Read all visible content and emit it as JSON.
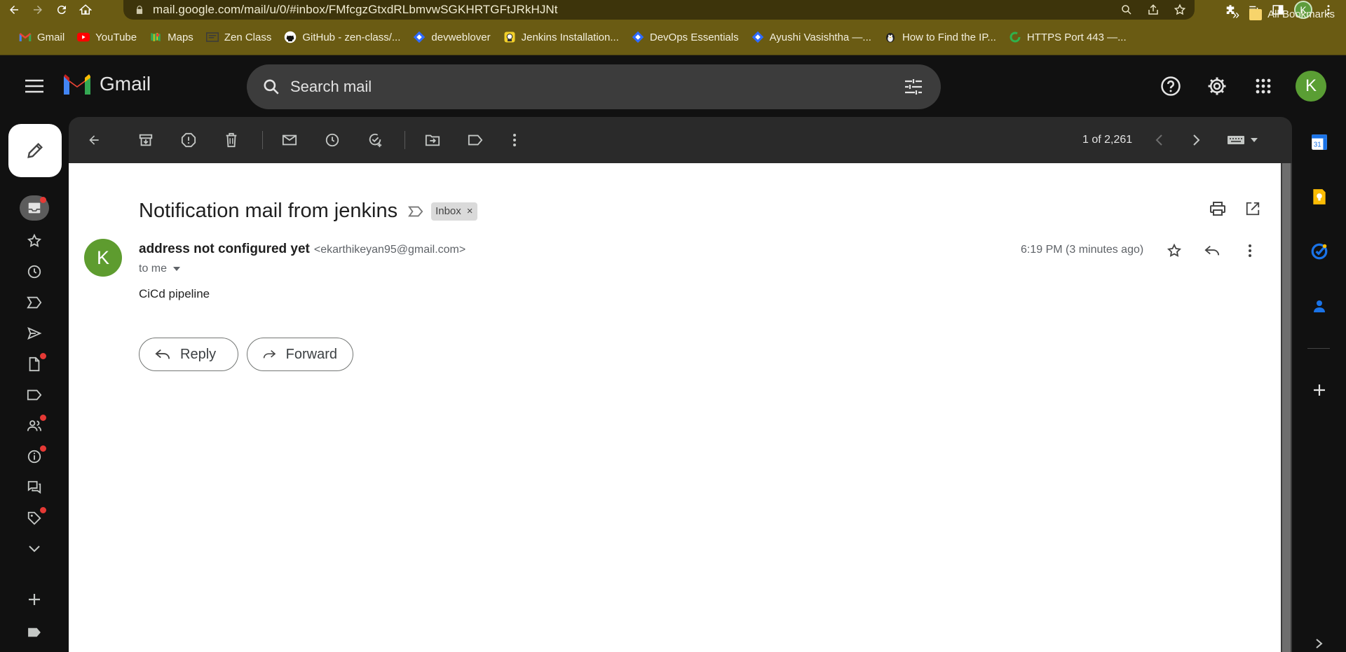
{
  "browser": {
    "url": "mail.google.com/mail/u/0/#inbox/FMfcgzGtxdRLbmvwSGKHRTGFtJRkHJNt",
    "profile_initial": "K"
  },
  "bookmarks": {
    "items": [
      {
        "label": "Gmail",
        "icon": "gmail-icon"
      },
      {
        "label": "YouTube",
        "icon": "youtube-icon"
      },
      {
        "label": "Maps",
        "icon": "maps-icon"
      },
      {
        "label": "Zen Class",
        "icon": "zen-class-icon"
      },
      {
        "label": "GitHub - zen-class/...",
        "icon": "github-icon"
      },
      {
        "label": "devweblover",
        "icon": "blue-diamond-icon"
      },
      {
        "label": "Jenkins Installation...",
        "icon": "jenkins-icon"
      },
      {
        "label": "DevOps Essentials",
        "icon": "blue-diamond-icon"
      },
      {
        "label": "Ayushi Vasishtha —...",
        "icon": "blue-diamond-icon"
      },
      {
        "label": "How to Find the IP...",
        "icon": "penguin-icon"
      },
      {
        "label": "HTTPS Port 443 —...",
        "icon": "green-arc-icon"
      }
    ],
    "more": "»",
    "all_bookmarks": "All Bookmarks"
  },
  "gmail": {
    "logo_text": "Gmail",
    "search_placeholder": "Search mail",
    "account_initial": "K"
  },
  "toolbar": {
    "pager": "1 of 2,261"
  },
  "message": {
    "subject": "Notification mail from jenkins",
    "label_chip": "Inbox",
    "chip_close": "×",
    "sender_name": "address not configured yet",
    "sender_email": "<ekarthikeyan95@gmail.com>",
    "to": "to me",
    "time": "6:19 PM (3 minutes ago)",
    "body": "CiCd pipeline",
    "sender_initial": "K"
  },
  "actions": {
    "reply": "Reply",
    "forward": "Forward"
  },
  "colors": {
    "chrome_bg": "#6a5b13",
    "gmail_bg": "#111111",
    "avatar_green": "#5e9c2f",
    "notification_dot": "#e53935"
  }
}
